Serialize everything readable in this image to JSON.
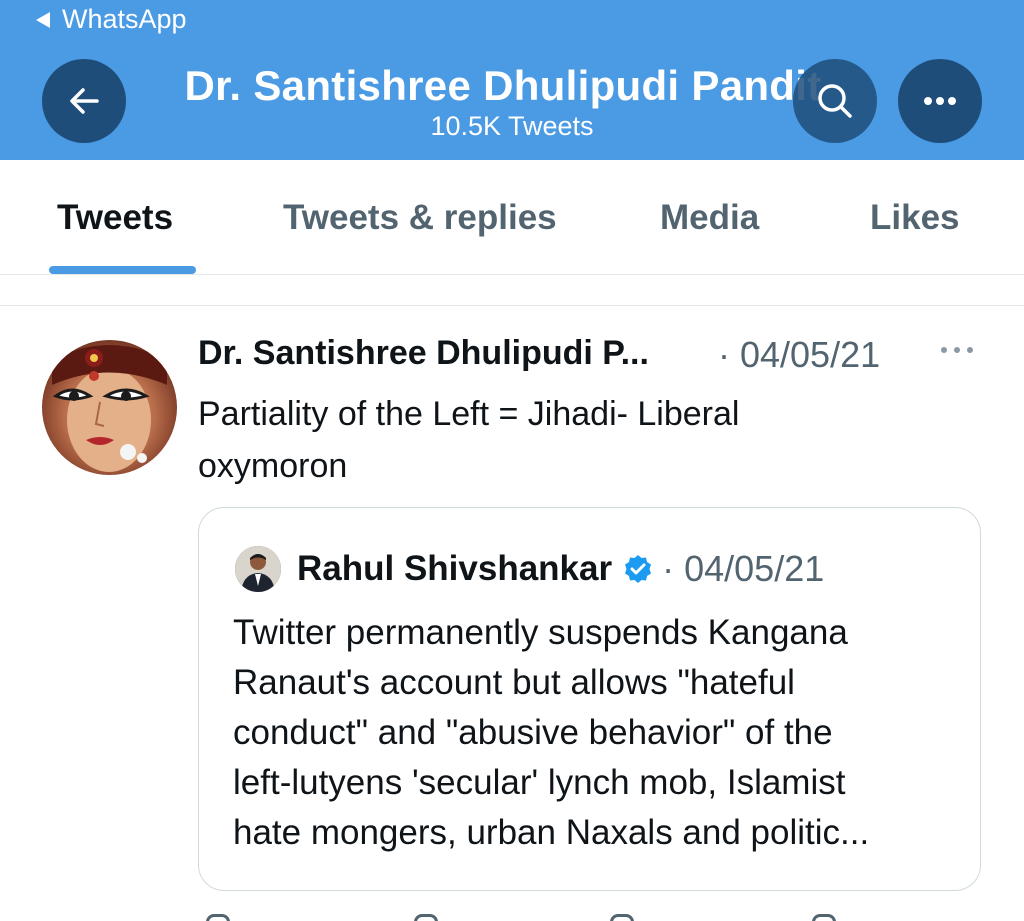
{
  "status_bar": {
    "back_app": "WhatsApp"
  },
  "header": {
    "title": "Dr. Santishree Dhulipudi Pandit",
    "subtitle": "10.5K Tweets",
    "back_icon": "arrow-left-icon",
    "search_icon": "search-icon",
    "more_icon": "more-horizontal-icon"
  },
  "tabs": [
    {
      "label": "Tweets",
      "active": true
    },
    {
      "label": "Tweets & replies",
      "active": false
    },
    {
      "label": "Media",
      "active": false
    },
    {
      "label": "Likes",
      "active": false
    }
  ],
  "tweet": {
    "author": "Dr. Santishree Dhulipudi P...",
    "date": "· 04/05/21",
    "text_line1": "Partiality of the Left = Jihadi- Liberal",
    "text_line2": "oxymoron",
    "quote": {
      "author": "Rahul Shivshankar",
      "verified": true,
      "date": "· 04/05/21",
      "lines": [
        "Twitter permanently suspends Kangana",
        "Ranaut's account but allows \"hateful",
        "conduct\" and \"abusive behavior\" of the",
        "left-lutyens 'secular' lynch mob, Islamist",
        "hate mongers, urban Naxals and politic..."
      ]
    }
  },
  "colors": {
    "header_bg": "#4a9ae4",
    "header_button": "#1f4d7a",
    "accent": "#4a9ae4",
    "verified": "#1d9bf0",
    "muted_text": "#536471"
  }
}
